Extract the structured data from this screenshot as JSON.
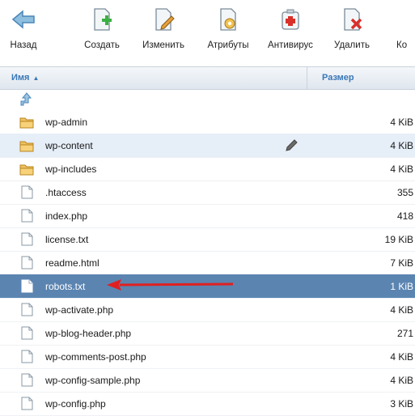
{
  "toolbar": {
    "back_label": "Назад",
    "create_label": "Создать",
    "edit_label": "Изменить",
    "attributes_label": "Атрибуты",
    "antivirus_label": "Антивирус",
    "delete_label": "Удалить",
    "cut_label": "Ко"
  },
  "table": {
    "col_name": "Имя",
    "col_size": "Размер",
    "sort_indicator": "▲"
  },
  "files": [
    {
      "name": "wp-admin",
      "size": "4 KiB",
      "type": "folder"
    },
    {
      "name": "wp-content",
      "size": "4 KiB",
      "type": "folder"
    },
    {
      "name": "wp-includes",
      "size": "4 KiB",
      "type": "folder"
    },
    {
      "name": ".htaccess",
      "size": "355",
      "type": "file"
    },
    {
      "name": "index.php",
      "size": "418",
      "type": "file"
    },
    {
      "name": "license.txt",
      "size": "19 KiB",
      "type": "file"
    },
    {
      "name": "readme.html",
      "size": "7 KiB",
      "type": "file"
    },
    {
      "name": "robots.txt",
      "size": "1 KiB",
      "type": "file"
    },
    {
      "name": "wp-activate.php",
      "size": "4 KiB",
      "type": "file"
    },
    {
      "name": "wp-blog-header.php",
      "size": "271",
      "type": "file"
    },
    {
      "name": "wp-comments-post.php",
      "size": "4 KiB",
      "type": "file"
    },
    {
      "name": "wp-config-sample.php",
      "size": "4 KiB",
      "type": "file"
    },
    {
      "name": "wp-config.php",
      "size": "3 KiB",
      "type": "file"
    }
  ],
  "colors": {
    "selected_row": "#5b84b1",
    "hover_row": "#e6eef8",
    "header_text": "#3a78b8",
    "annotation_arrow": "#e02020"
  }
}
